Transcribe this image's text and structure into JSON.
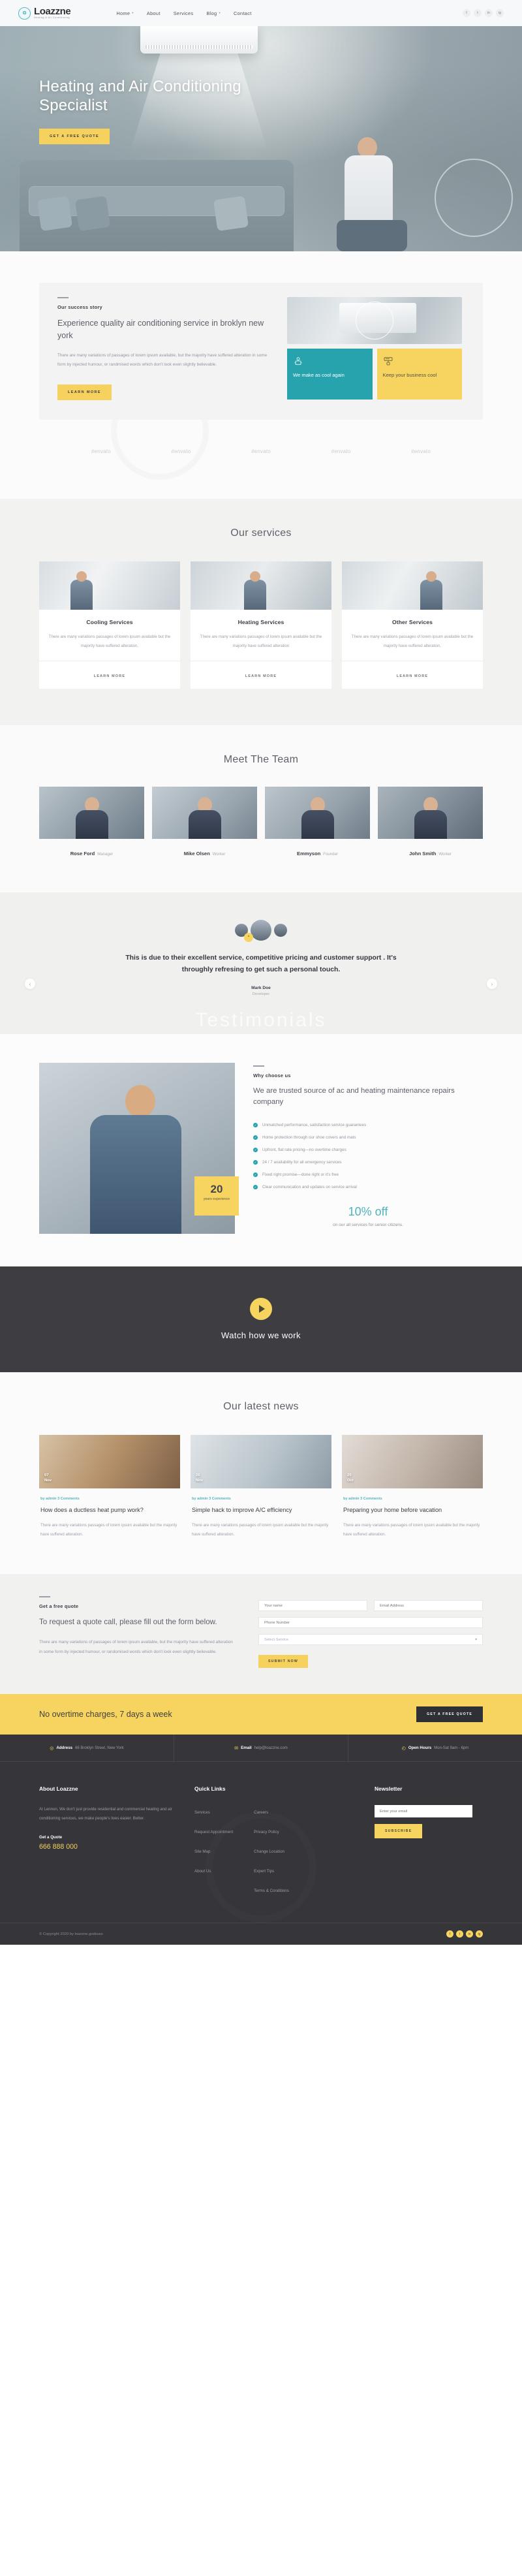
{
  "brand": {
    "name": "Loazzne",
    "tagline": "Heating & Air Conditioning"
  },
  "colors": {
    "yellow": "#f7d45f",
    "teal": "#27a3ae",
    "dark": "#35353a",
    "accent_blue": "#4fb3bd"
  },
  "nav": {
    "items": [
      {
        "label": "Home",
        "caret": "▾"
      },
      {
        "label": "About",
        "caret": ""
      },
      {
        "label": "Services",
        "caret": ""
      },
      {
        "label": "Blog",
        "caret": "▾"
      },
      {
        "label": "Contact",
        "caret": ""
      }
    ],
    "social": [
      "f",
      "t",
      "in",
      "ig"
    ]
  },
  "hero": {
    "title": "Heating and Air Conditioning Specialist",
    "cta": "GET A FREE QUOTE"
  },
  "about": {
    "eyebrow": "Our success story",
    "title": "Experience quality air conditioning service in broklyn new york",
    "paragraph": "There are many variations of passages of lorem ipsum available, but the majority have suffered alteration in some form by injected humour, or randmised words which don't look even slightly believable.",
    "cta": "LEARN MORE",
    "tiles": [
      {
        "icon": "ac-fan-icon",
        "text": "We make as cool again"
      },
      {
        "icon": "ac-unit-icon",
        "text": "Keep your business cool"
      }
    ]
  },
  "brands": [
    "#envato",
    "#envato",
    "#envato",
    "#envato",
    "#envato"
  ],
  "services": {
    "title": "Our services",
    "cards": [
      {
        "name": "Cooling Services",
        "desc": "There are many variations passages of lorem ipsum available but the majority have suffered alteration.",
        "cta": "LEARN MORE"
      },
      {
        "name": "Heating Services",
        "desc": "There are many variations passages of lorem ipsum available but the majority have suffered alteration",
        "cta": "LEARN MORE"
      },
      {
        "name": "Other Services",
        "desc": "There are many variations passages of lorem ipsum available but the majority have suffered alteration.",
        "cta": "LEARN MORE"
      }
    ]
  },
  "team": {
    "title": "Meet The Team",
    "members": [
      {
        "name": "Rose Ford",
        "role": "Manager"
      },
      {
        "name": "Mike Olsen",
        "role": "Worker"
      },
      {
        "name": "Emmyson",
        "role": "Founder"
      },
      {
        "name": "John Smith",
        "role": "Worker"
      }
    ]
  },
  "testimonial": {
    "quote": "This is due to their excellent service, competitive pricing and customer support . It's throughly refresing to get such a personal touch.",
    "name": "Mark Doe",
    "role": "Developer",
    "watermark": "Testimonials",
    "prev": "‹",
    "next": "›"
  },
  "why": {
    "eyebrow": "Why choose us",
    "title": "We are trusted source of ac and heating maintenance repairs company",
    "points": [
      "Unmatched performance, satisfaction service guarantees",
      "Home protection through our shoe covers and mats",
      "Upfront, flat rate pricing—no overtime charges",
      "24 / 7 availability for all emergency services",
      "Fixed right promise—done right or it's free",
      "Clear communication and updates on service arrival"
    ],
    "badge_number": "20",
    "badge_label": "years experience",
    "offer_number": "10% off",
    "offer_sub": "on our all services for senior citizens."
  },
  "video": {
    "title": "Watch how we work",
    "play": "play-button"
  },
  "news": {
    "title": "Our latest news",
    "posts": [
      {
        "day": "07",
        "month": "Nov",
        "meta": "by admin  3 Comments",
        "title": "How does a ductless heat pump work?",
        "desc": "There are many variations passages of lorem ipsum available but the majority have suffered alteration."
      },
      {
        "day": "26",
        "month": "Nov",
        "meta": "by admin  3 Comments",
        "title": "Simple hack to improve A/C efficiency",
        "desc": "There are many variations passages of lorem ipsum available but the majority have suffered alteration."
      },
      {
        "day": "20",
        "month": "Oct",
        "meta": "by admin  3 Comments",
        "title": "Preparing your home before vacation",
        "desc": "There are many variations passages of lorem ipsum available but the majority have suffered alteration."
      }
    ]
  },
  "quote": {
    "eyebrow": "Get a free quote",
    "title": "To request a quote call, please fill out the form below.",
    "paragraph": "There are many variations of passages of lorem ipsum available, but the majority have suffered alteration in some form by injected humour, or randomised words which don't look even slightly believable.",
    "name_placeholder": "Your name",
    "email_placeholder": "Email Address",
    "phone_placeholder": "Phone Number",
    "select_value": "Select Service",
    "select_caret": "▾",
    "submit": "SUBMIT NOW"
  },
  "cta": {
    "text": "No overtime charges, 7 days a week",
    "button": "GET A FREE QUOTE"
  },
  "footer": {
    "info": [
      {
        "icon": "location-pin-icon",
        "glyph": "◎",
        "label": "Address",
        "value": "66 Broklyn Street, New York"
      },
      {
        "icon": "envelope-icon",
        "glyph": "✉",
        "label": "Email",
        "value": "help@loazzne.com"
      },
      {
        "icon": "clock-icon",
        "glyph": "◴",
        "label": "Open Hours",
        "value": "Mon-Sat  9am - 6pm"
      }
    ],
    "about": {
      "heading": "About Loazzne",
      "text": "At Lennon, We don't just provide residential and commercial heating and air conditioning services, we make people's lives easier. Better.",
      "quote_label": "Get a Quote",
      "phone": "666 888 000"
    },
    "quick": {
      "heading": "Quick Links",
      "col1": [
        "Services",
        "Request Appointment",
        "Site Map",
        "About Us"
      ],
      "col2": [
        "Careers",
        "Privacy Policy",
        "Change Location",
        "Expert Tips",
        "Terms & Conditions"
      ]
    },
    "newsletter": {
      "heading": "Newsletter",
      "placeholder": "Enter your email",
      "button": "SUBSCRIBE"
    },
    "copyright": "© Copyright 2020 by loazzne.godsuss",
    "social": [
      "f",
      "t",
      "in",
      "ig"
    ]
  }
}
